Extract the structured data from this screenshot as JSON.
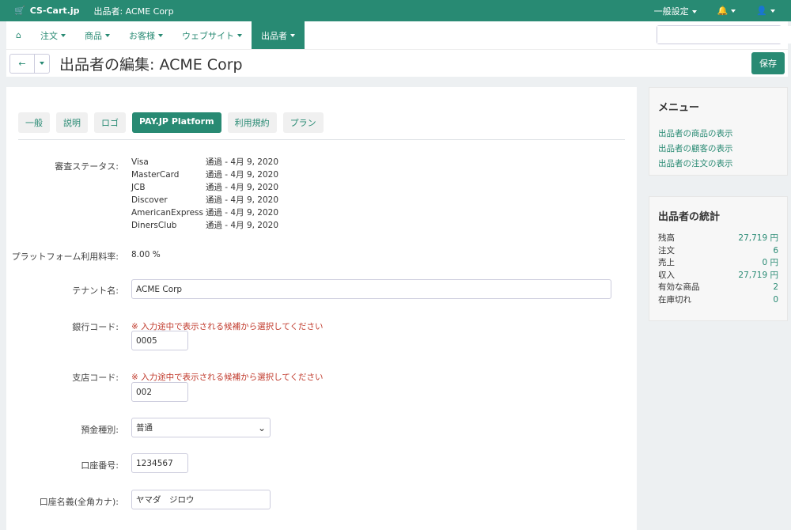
{
  "topbar": {
    "brand": "CS-Cart.jp",
    "vendor": "出品者: ACME Corp",
    "settings": "一般設定"
  },
  "nav": {
    "items": [
      "注文",
      "商品",
      "お客様",
      "ウェブサイト",
      "出品者"
    ]
  },
  "page": {
    "title": "出品者の編集: ACME Corp",
    "save": "保存"
  },
  "tabs": [
    "一般",
    "説明",
    "ロゴ",
    "PAY.JP Platform",
    "利用規約",
    "プラン"
  ],
  "form": {
    "review_label": "審査ステータス:",
    "brands": [
      {
        "name": "Visa",
        "status": "通過 - 4月 9, 2020"
      },
      {
        "name": "MasterCard",
        "status": "通過 - 4月 9, 2020"
      },
      {
        "name": "JCB",
        "status": "通過 - 4月 9, 2020"
      },
      {
        "name": "Discover",
        "status": "通過 - 4月 9, 2020"
      },
      {
        "name": "AmericanExpress",
        "status": "通過 - 4月 9, 2020"
      },
      {
        "name": "DinersClub",
        "status": "通過 - 4月 9, 2020"
      }
    ],
    "fee_label": "プラットフォーム利用料率:",
    "fee_value": "8.00 %",
    "tenant_label": "テナント名:",
    "tenant_value": "ACME Corp",
    "bank_label": "銀行コード:",
    "bank_note": "※ 入力途中で表示される候補から選択してください",
    "bank_value": "0005",
    "branch_label": "支店コード:",
    "branch_note": "※ 入力途中で表示される候補から選択してください",
    "branch_value": "002",
    "type_label": "預金種別:",
    "type_value": "普通",
    "account_label": "口座番号:",
    "account_value": "1234567",
    "holder_label": "口座名義(全角カナ):",
    "holder_value": "ヤマダ　ジロウ"
  },
  "menu": {
    "title": "メニュー",
    "links": [
      "出品者の商品の表示",
      "出品者の顧客の表示",
      "出品者の注文の表示"
    ]
  },
  "stats": {
    "title": "出品者の統計",
    "rows": [
      {
        "k": "残高",
        "v": "27,719 円"
      },
      {
        "k": "注文",
        "v": "6"
      },
      {
        "k": "売上",
        "v": "0 円"
      },
      {
        "k": "収入",
        "v": "27,719 円"
      },
      {
        "k": "有効な商品",
        "v": "2"
      },
      {
        "k": "在庫切れ",
        "v": "0"
      }
    ]
  }
}
